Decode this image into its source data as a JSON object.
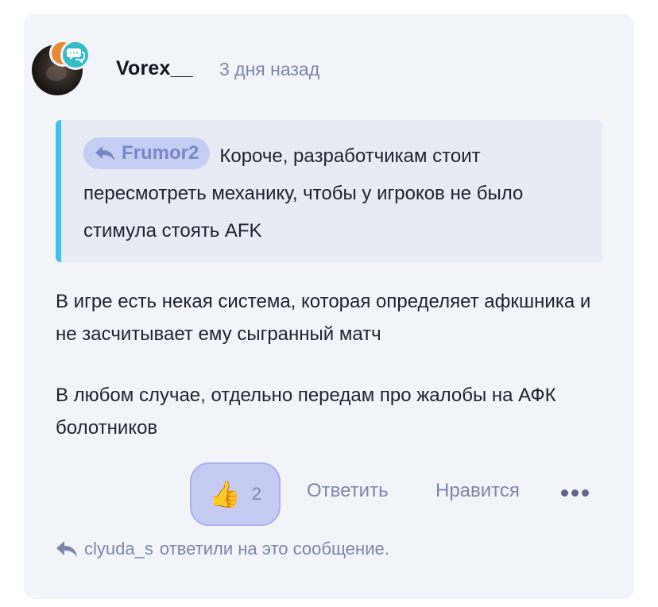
{
  "post": {
    "author": "Vorex__",
    "timestamp": "3 дня назад",
    "avatar_badges": [
      "orange-badge",
      "chat-bubbles-icon"
    ],
    "quote": {
      "author": "Frumor2",
      "text": "Короче, разработчикам стоит пересмотреть механику, чтобы у игроков не было стимула стоять AFK"
    },
    "paragraphs": [
      "В игре есть некая система, которая определяет афкшника и не засчитывает ему сыгранный матч",
      "В любом случае, отдельно передам про жалобы на АФК болотников"
    ]
  },
  "actions": {
    "reaction_emoji": "👍",
    "reaction_count": "2",
    "reply_label": "Ответить",
    "like_label": "Нравится",
    "more_icon": "ellipsis-icon"
  },
  "replied_notice": {
    "user": "clyuda_s",
    "text": "ответили на это сообщение."
  },
  "colors": {
    "card_bg": "#f3f4f9",
    "quote_accent": "#3fc1f2",
    "chip_bg": "#c6cdf3",
    "muted": "#7d86a8"
  }
}
